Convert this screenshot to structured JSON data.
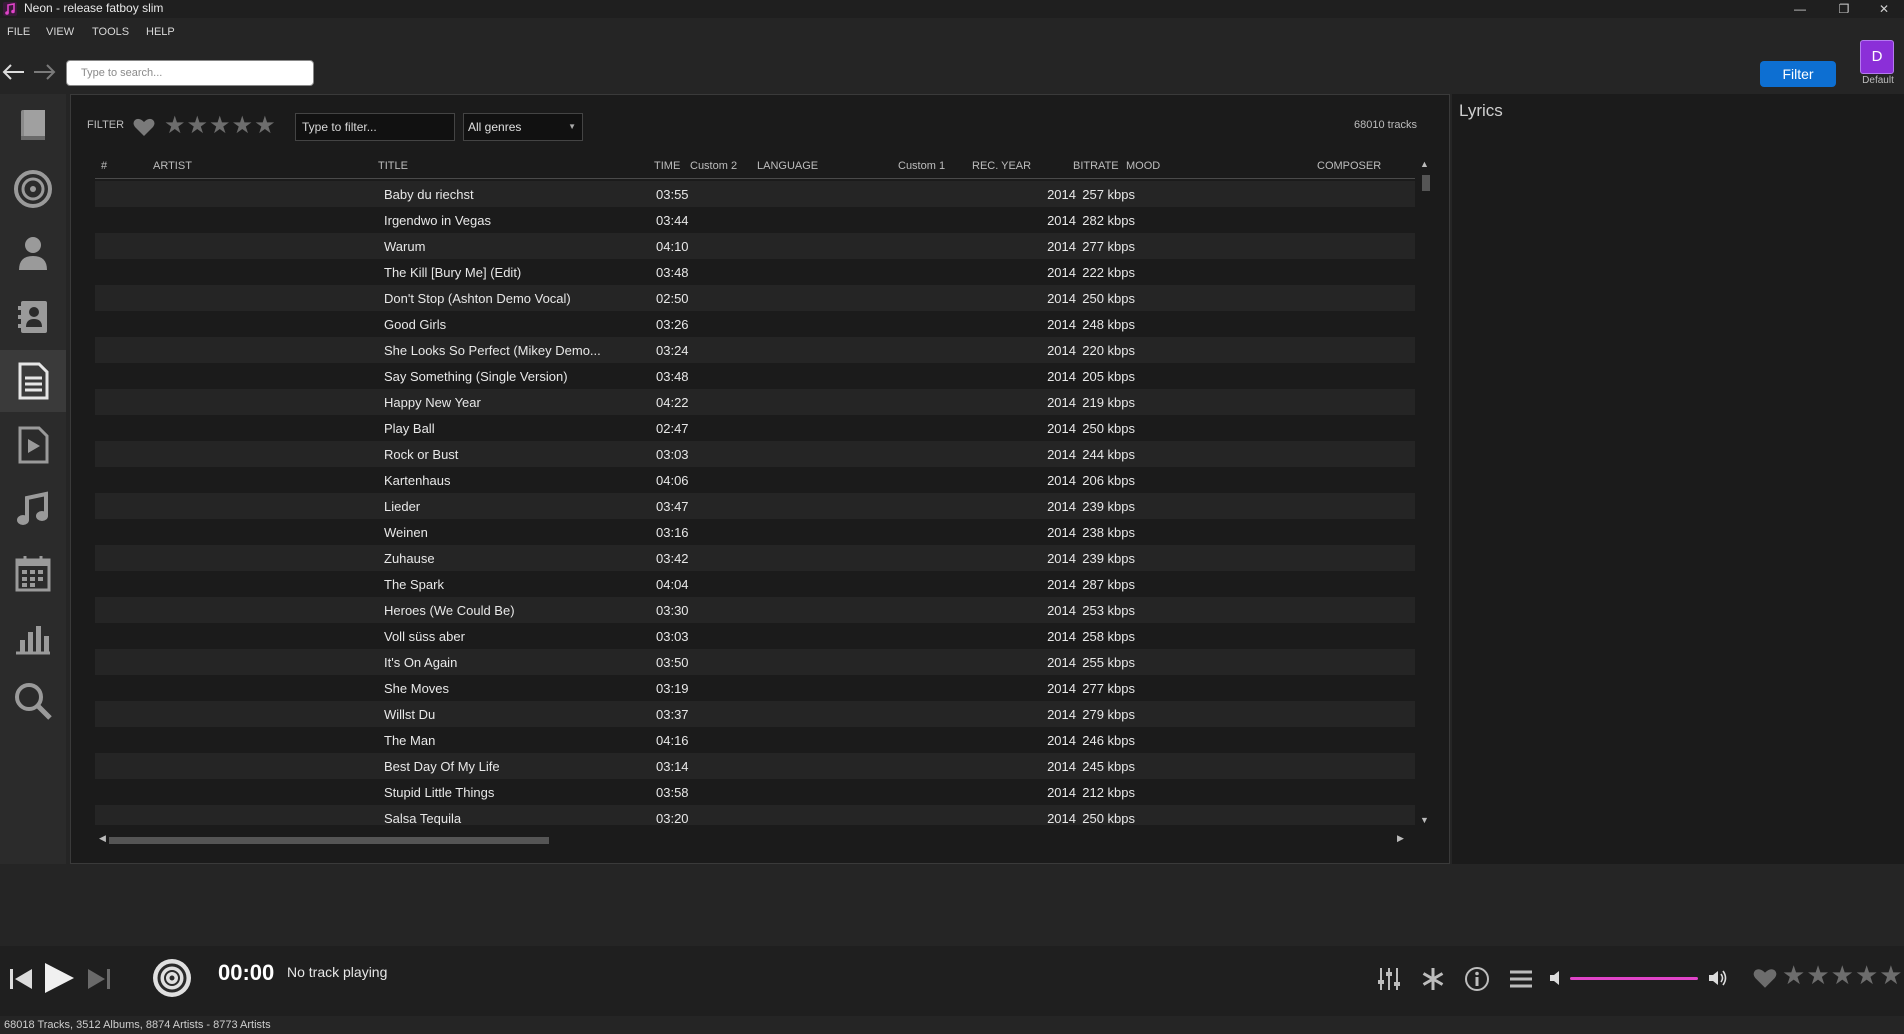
{
  "window": {
    "title": "Neon - release fatboy slim",
    "minimize": "—",
    "restore": "❐",
    "close": "✕"
  },
  "menu": [
    "FILE",
    "VIEW",
    "TOOLS",
    "HELP"
  ],
  "search": {
    "placeholder": "Type to search..."
  },
  "header": {
    "filter_button": "Filter",
    "avatar_letter": "D",
    "avatar_label": "Default"
  },
  "sidebar": {
    "items": [
      {
        "name": "library-icon"
      },
      {
        "name": "disc-icon"
      },
      {
        "name": "artist-icon"
      },
      {
        "name": "contacts-icon"
      },
      {
        "name": "document-icon",
        "active": true
      },
      {
        "name": "video-icon"
      },
      {
        "name": "music-note-icon"
      },
      {
        "name": "calendar-icon"
      },
      {
        "name": "chart-icon"
      },
      {
        "name": "search-icon"
      }
    ]
  },
  "filter_bar": {
    "label": "FILTER",
    "filter_placeholder": "Type to filter...",
    "genre": "All genres",
    "track_count": "68010 tracks"
  },
  "table": {
    "columns": {
      "num": "#",
      "artist": "ARTIST",
      "title": "TITLE",
      "time": "TIME",
      "custom2": "Custom 2",
      "language": "LANGUAGE",
      "custom1": "Custom 1",
      "rec_year": "REC. YEAR",
      "bitrate": "BITRATE",
      "mood": "MOOD",
      "composer": "COMPOSER"
    },
    "rows": [
      {
        "title": "Baby du riechst",
        "time": "03:55",
        "year": "2014",
        "bitrate": "257 kbps"
      },
      {
        "title": "Irgendwo in Vegas",
        "time": "03:44",
        "year": "2014",
        "bitrate": "282 kbps"
      },
      {
        "title": "Warum",
        "time": "04:10",
        "year": "2014",
        "bitrate": "277 kbps"
      },
      {
        "title": "The Kill [Bury Me] (Edit)",
        "time": "03:48",
        "year": "2014",
        "bitrate": "222 kbps"
      },
      {
        "title": "Don't Stop (Ashton Demo Vocal)",
        "time": "02:50",
        "year": "2014",
        "bitrate": "250 kbps"
      },
      {
        "title": "Good Girls",
        "time": "03:26",
        "year": "2014",
        "bitrate": "248 kbps"
      },
      {
        "title": "She Looks So Perfect (Mikey Demo...",
        "time": "03:24",
        "year": "2014",
        "bitrate": "220 kbps"
      },
      {
        "title": "Say Something  (Single Version)",
        "time": "03:48",
        "year": "2014",
        "bitrate": "205 kbps"
      },
      {
        "title": "Happy New Year",
        "time": "04:22",
        "year": "2014",
        "bitrate": "219 kbps"
      },
      {
        "title": "Play Ball",
        "time": "02:47",
        "year": "2014",
        "bitrate": "250 kbps"
      },
      {
        "title": "Rock or Bust",
        "time": "03:03",
        "year": "2014",
        "bitrate": "244 kbps"
      },
      {
        "title": "Kartenhaus",
        "time": "04:06",
        "year": "2014",
        "bitrate": "206 kbps"
      },
      {
        "title": "Lieder",
        "time": "03:47",
        "year": "2014",
        "bitrate": "239 kbps"
      },
      {
        "title": "Weinen",
        "time": "03:16",
        "year": "2014",
        "bitrate": "238 kbps"
      },
      {
        "title": "Zuhause",
        "time": "03:42",
        "year": "2014",
        "bitrate": "239 kbps"
      },
      {
        "title": "The Spark",
        "time": "04:04",
        "year": "2014",
        "bitrate": "287 kbps"
      },
      {
        "title": "Heroes (We Could Be)",
        "time": "03:30",
        "year": "2014",
        "bitrate": "253 kbps"
      },
      {
        "title": "Voll süss aber",
        "time": "03:03",
        "year": "2014",
        "bitrate": "258 kbps"
      },
      {
        "title": "It's On Again",
        "time": "03:50",
        "year": "2014",
        "bitrate": "255 kbps"
      },
      {
        "title": "She Moves",
        "time": "03:19",
        "year": "2014",
        "bitrate": "277 kbps"
      },
      {
        "title": "Willst Du",
        "time": "03:37",
        "year": "2014",
        "bitrate": "279 kbps"
      },
      {
        "title": "The Man",
        "time": "04:16",
        "year": "2014",
        "bitrate": "246 kbps"
      },
      {
        "title": "Best Day Of My Life",
        "time": "03:14",
        "year": "2014",
        "bitrate": "245 kbps"
      },
      {
        "title": "Stupid Little Things",
        "time": "03:58",
        "year": "2014",
        "bitrate": "212 kbps"
      },
      {
        "title": "Salsa Tequila",
        "time": "03:20",
        "year": "2014",
        "bitrate": "250 kbps"
      }
    ]
  },
  "lyrics": {
    "title": "Lyrics"
  },
  "player": {
    "time": "00:00",
    "status": "No track playing",
    "volume_level": 1.0
  },
  "statusbar": {
    "text": "68018 Tracks, 3512 Albums, 8874 Artists - 8773 Artists"
  },
  "colors": {
    "accent": "#0d6fd2",
    "avatar": "#8b2fd8",
    "volume": "#e044c8"
  }
}
